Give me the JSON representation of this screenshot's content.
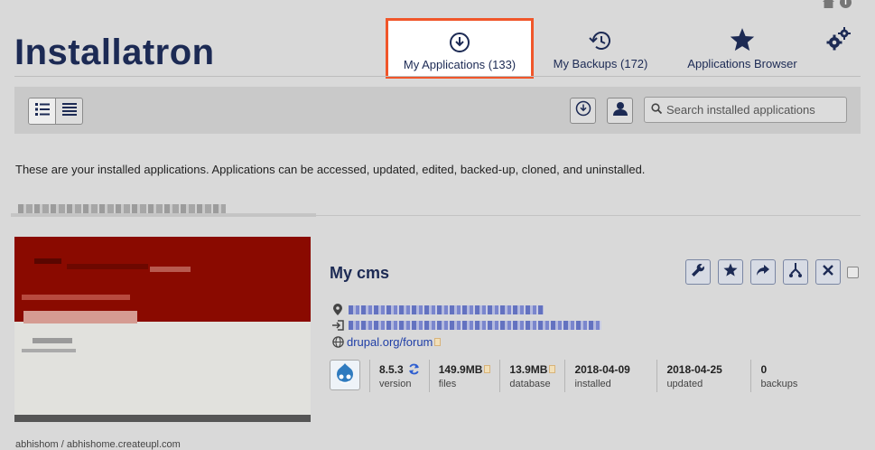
{
  "header": {
    "logo_text": "Installatron",
    "tabs": [
      {
        "label": "My Applications (133)",
        "icon": "download-circle-icon",
        "active": true
      },
      {
        "label": "My Backups (172)",
        "icon": "history-icon",
        "active": false
      },
      {
        "label": "Applications Browser",
        "icon": "star-icon",
        "active": false
      }
    ],
    "settings_icon": "gears-icon",
    "top_icons": [
      "home-icon",
      "info-icon"
    ]
  },
  "toolbar": {
    "view_modes": [
      "list-detail-icon",
      "list-compact-icon"
    ],
    "search_placeholder": "Search installed applications"
  },
  "intro_text": "These are your installed applications. Applications can be accessed, updated, edited, backed-up, cloned, and uninstalled.",
  "application": {
    "title": "My cms",
    "forum_link": "drupal.org/forum",
    "stats": [
      {
        "value": "8.5.3",
        "label": "version"
      },
      {
        "value": "149.9MB",
        "label": "files"
      },
      {
        "value": "13.9MB",
        "label": "database"
      },
      {
        "value": "2018-04-09",
        "label": "installed"
      },
      {
        "value": "2018-04-25",
        "label": "updated"
      },
      {
        "value": "0",
        "label": "backups"
      }
    ]
  },
  "footer_text": "abhishom / abhishome.createupl.com",
  "colors": {
    "brand": "#1c2a54",
    "active_tab_border": "#f0562a",
    "link": "#1f3ea6",
    "page_bg": "#d9d9d9"
  }
}
